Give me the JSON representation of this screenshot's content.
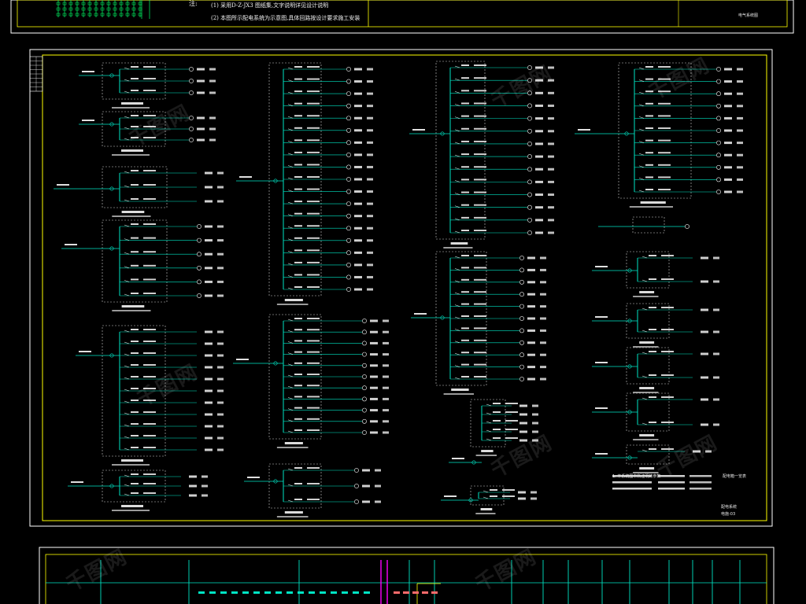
{
  "title_block": {
    "note_label": "注:",
    "note_1": "(1) 采用D-Z-JX3 图纸集,文字说明详见设计说明",
    "note_2": "(2) 本图所示配电系统为示意图,具体回路按设计要求施工安装",
    "sheet_tag": "电气系统图"
  },
  "footer": {
    "left_note": "1. 本系统图中所注明的参数",
    "right_note": "配电箱一览表",
    "sheet_name": "配电系统",
    "drawing_no": "电施-03"
  },
  "colors": {
    "background": "#000000",
    "frame": "#ffffff",
    "inner_frame": "#ffff00",
    "circuit": "#00e5c4",
    "text": "#ffffff",
    "dashed": "#d0d0d0",
    "magenta": "#ff00ff",
    "top_green": "#00ff66"
  },
  "watermark": "千图网"
}
